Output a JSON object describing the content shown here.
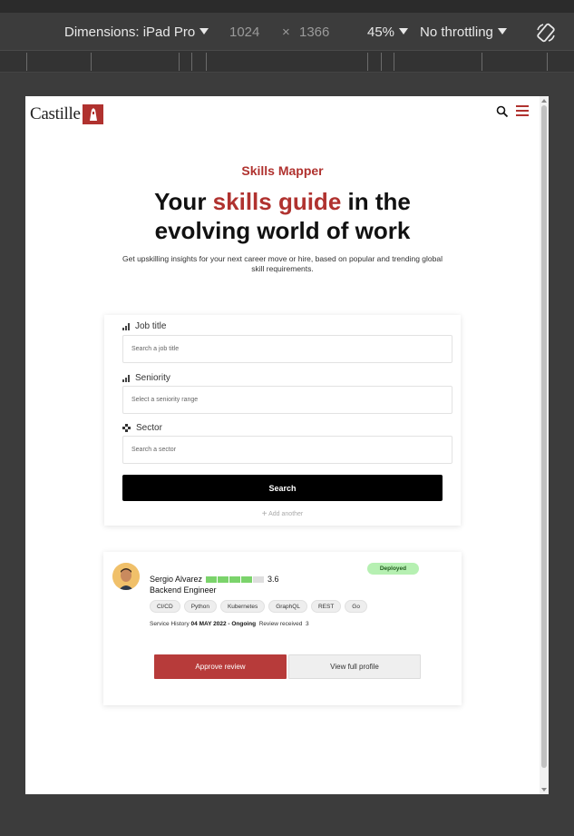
{
  "devtools": {
    "dimensions_label": "Dimensions: iPad Pro",
    "width": "1024",
    "separator": "×",
    "height": "1366",
    "zoom": "45%",
    "throttling": "No throttling",
    "icons": [
      "caret-down-icon",
      "rotate-device-icon"
    ]
  },
  "header": {
    "logo_text": "Castille",
    "icons": [
      "search-icon",
      "hamburger-menu-icon"
    ],
    "accent_color": "#b0322f"
  },
  "hero": {
    "eyebrow": "Skills Mapper",
    "headline_part1": "Your ",
    "headline_accent": "skills guide",
    "headline_part2": " in the",
    "headline_line2": "evolving world of work",
    "subcopy": "Get upskilling insights for your next career move or hire, based on popular and trending global skill requirements."
  },
  "search_form": {
    "fields": [
      {
        "label": "Job title",
        "placeholder": "Search a job title",
        "icon": "bar-chart-icon"
      },
      {
        "label": "Seniority",
        "placeholder": "Select a seniority range",
        "icon": "bar-chart-icon"
      },
      {
        "label": "Sector",
        "placeholder": "Search a sector",
        "icon": "diamond-grid-icon"
      }
    ],
    "search_label": "Search",
    "add_another": "Add another"
  },
  "profile": {
    "name": "Sergio Alvarez",
    "rating": "3.6",
    "rating_fraction": 0.72,
    "role": "Backend Engineer",
    "status": "Deployed",
    "tags": [
      "CI/CD",
      "Python",
      "Kubernetes",
      "GraphQL",
      "REST",
      "Go"
    ],
    "history_label": "Service History",
    "history_dates": "04 MAY 2022 - Ongoing",
    "review_label": "Review received",
    "review_count": "3",
    "approve_label": "Approve review",
    "view_profile_label": "View full profile",
    "status_color": "#b6f0b2",
    "meter_color": "#7bd36b"
  }
}
